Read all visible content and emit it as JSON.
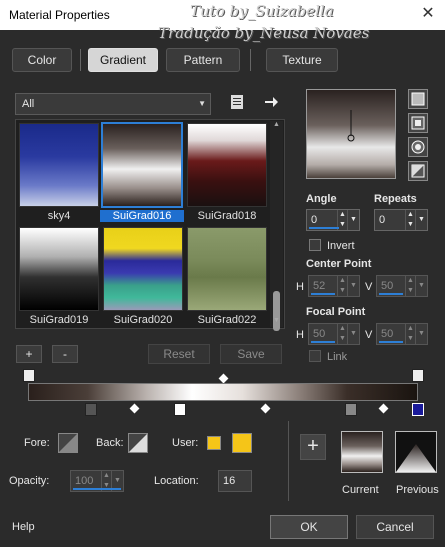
{
  "window": {
    "title": "Material Properties",
    "close_glyph": "✕"
  },
  "watermark": {
    "line1": "Tuto by_Suizabella",
    "line2": "Tradução by_Neusa Novaes"
  },
  "tabs": [
    {
      "label": "Color"
    },
    {
      "label": "Gradient"
    },
    {
      "label": "Pattern"
    },
    {
      "label": "Texture"
    }
  ],
  "category": {
    "value": "All"
  },
  "gradients": [
    {
      "name": "sky4",
      "selected": false
    },
    {
      "name": "SuiGrad016",
      "selected": true
    },
    {
      "name": "SuiGrad018",
      "selected": false
    },
    {
      "name": "SuiGrad019",
      "selected": false
    },
    {
      "name": "SuiGrad020",
      "selected": false
    },
    {
      "name": "SuiGrad022",
      "selected": false
    }
  ],
  "list_buttons": {
    "add": "+",
    "remove": "-",
    "reset": "Reset",
    "save": "Save"
  },
  "angle": {
    "label": "Angle",
    "value": "0"
  },
  "repeats": {
    "label": "Repeats",
    "value": "0"
  },
  "invert": {
    "label": "Invert"
  },
  "center_point": {
    "label": "Center Point",
    "h_label": "H",
    "h_value": "52",
    "v_label": "V",
    "v_value": "50"
  },
  "focal_point": {
    "label": "Focal Point",
    "h_label": "H",
    "h_value": "50",
    "v_label": "V",
    "v_value": "50"
  },
  "link": {
    "label": "Link"
  },
  "fore": {
    "label": "Fore:"
  },
  "back": {
    "label": "Back:"
  },
  "user": {
    "label": "User:"
  },
  "opacity": {
    "label": "Opacity:",
    "value": "100"
  },
  "location": {
    "label": "Location:",
    "value": "16"
  },
  "current": {
    "label": "Current"
  },
  "previous": {
    "label": "Previous"
  },
  "footer": {
    "help": "Help",
    "ok": "OK",
    "cancel": "Cancel"
  },
  "colors": {
    "accent": "#2d7fd6",
    "user_swatch": "#f5c518"
  }
}
